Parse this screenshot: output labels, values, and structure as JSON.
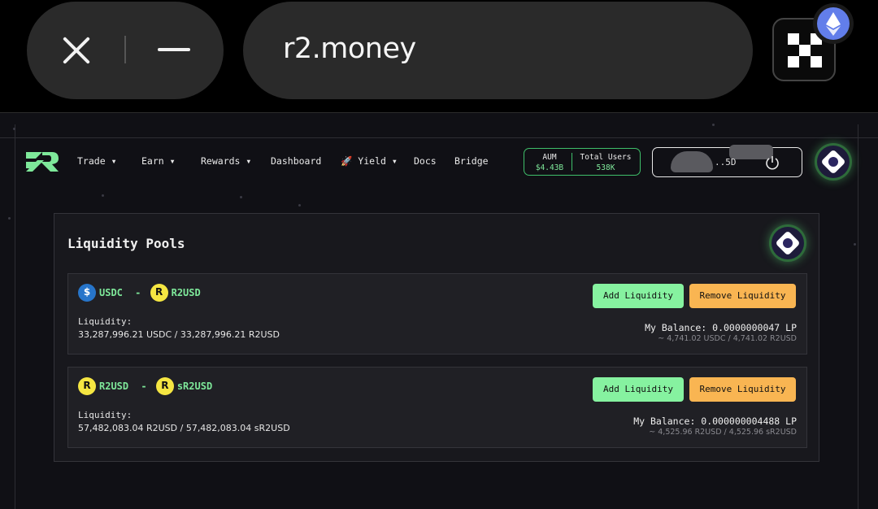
{
  "browser": {
    "url": "r2.money"
  },
  "nav": {
    "items": [
      {
        "label": "Trade",
        "dropdown": true
      },
      {
        "label": "Earn",
        "dropdown": true
      },
      {
        "label": "Rewards",
        "dropdown": true
      },
      {
        "label": "Dashboard",
        "dropdown": false
      },
      {
        "label": "Yield",
        "dropdown": true,
        "icon": "rocket-icon"
      },
      {
        "label": "Docs",
        "dropdown": false
      },
      {
        "label": "Bridge",
        "dropdown": false
      }
    ],
    "stats": {
      "aum_label": "AUM",
      "aum_value": "$4.43B",
      "users_label": "Total Users",
      "users_value": "538K"
    },
    "wallet_suffix": "..5D"
  },
  "page": {
    "title": "Liquidity Pools",
    "liquidity_label": "Liquidity:",
    "add_label": "Add Liquidity",
    "remove_label": "Remove Liquidity"
  },
  "pools": [
    {
      "token_a": "USDC",
      "token_b": "R2USD",
      "separator": "-",
      "liquidity": "33,287,996.21 USDC / 33,287,996.21 R2USD",
      "balance": "My Balance: 0.0000000047 LP",
      "balance_detail": "~ 4,741.02 USDC / 4,741.02 R2USD"
    },
    {
      "token_a": "R2USD",
      "token_b": "sR2USD",
      "separator": "-",
      "liquidity": "57,482,083.04 R2USD / 57,482,083.04 sR2USD",
      "balance": "My Balance: 0.000000004488 LP",
      "balance_detail": "~ 4,525.96 R2USD / 4,525.96 sR2USD"
    }
  ],
  "colors": {
    "accent_green": "#7ee89a",
    "add_button": "#86f2a0",
    "remove_button": "#f9b552",
    "panel_bg": "#18181d"
  }
}
